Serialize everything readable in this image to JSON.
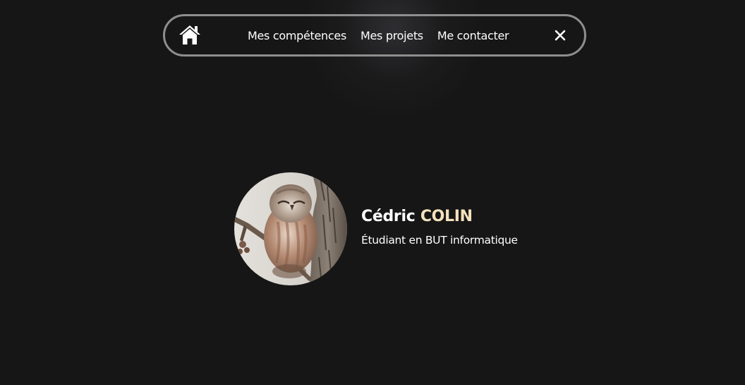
{
  "nav": {
    "home_icon": "home-icon",
    "links": [
      "Mes compétences",
      "Mes projets",
      "Me contacter"
    ],
    "close_icon": "close-icon"
  },
  "profile": {
    "first_name": "Cédric",
    "last_name": "COLIN",
    "subtitle": "Étudiant en BUT informatique",
    "avatar": "owl-photo"
  },
  "colors": {
    "background": "#161616",
    "accent": "#f4e2bd",
    "nav_border": "#8e8e8e",
    "text": "#ffffff"
  }
}
